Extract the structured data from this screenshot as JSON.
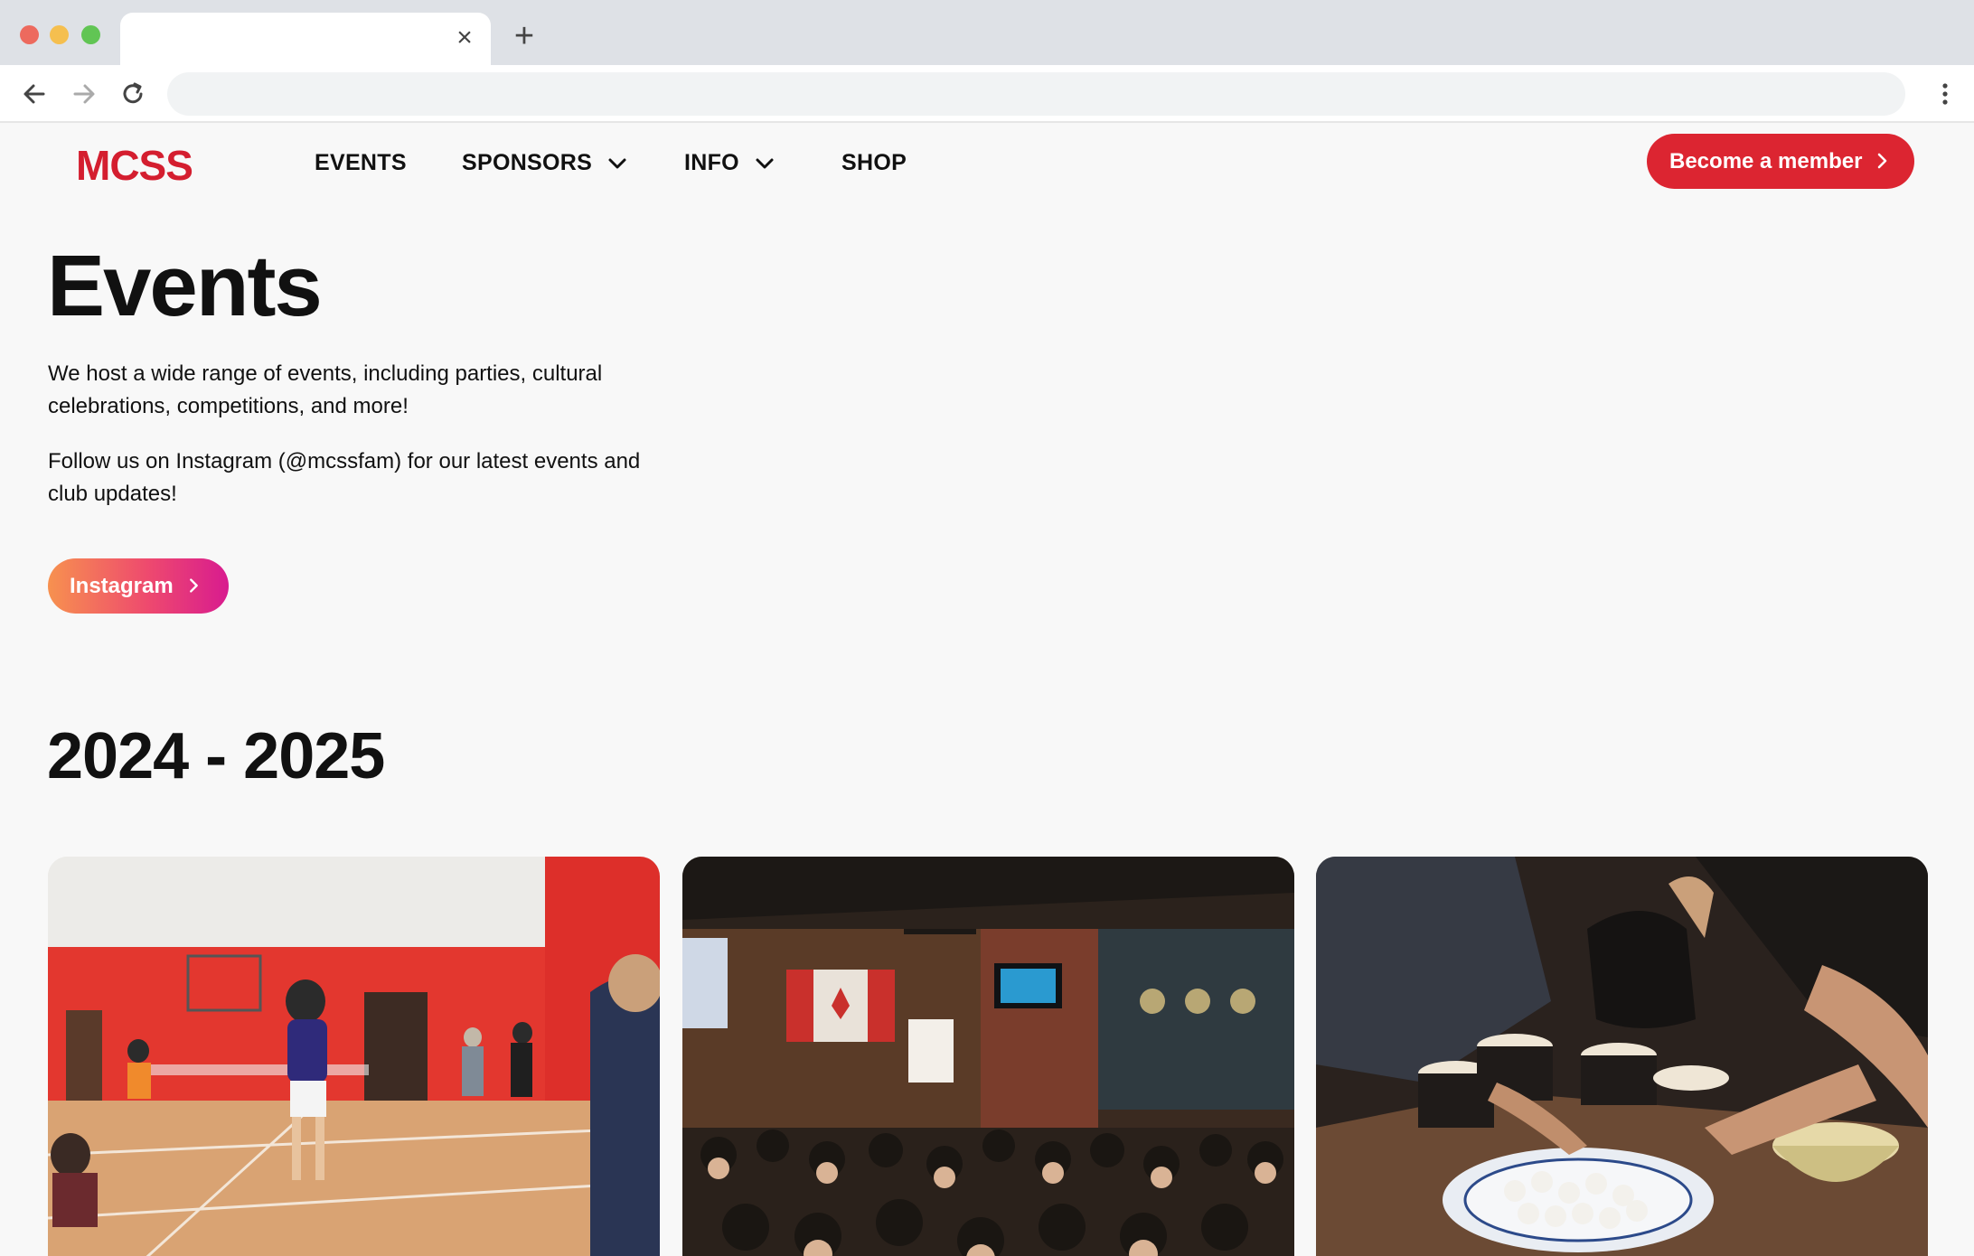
{
  "browser": {
    "tab_title": "",
    "url": "",
    "close_glyph": "×",
    "new_tab_glyph": "+"
  },
  "header": {
    "logo": "MCSS",
    "nav": {
      "events": "EVENTS",
      "sponsors": "SPONSORS",
      "info": "INFO",
      "shop": "SHOP"
    },
    "cta_label": "Become a member",
    "brand_color": "#dc2531"
  },
  "hero": {
    "title": "Events",
    "paragraph_1": "We host a wide range of events, including parties, cultural celebrations, competitions, and more!",
    "paragraph_2": "Follow us on Instagram (@mcssfam) for our latest events and club updates!",
    "instagram_label": "Instagram"
  },
  "section": {
    "year_heading": "2024 - 2025"
  },
  "cards": [
    {
      "name": "badminton-photo",
      "icon": "photo"
    },
    {
      "name": "pub-gathering-photo",
      "icon": "photo"
    },
    {
      "name": "tangyuan-making-photo",
      "icon": "photo"
    }
  ]
}
